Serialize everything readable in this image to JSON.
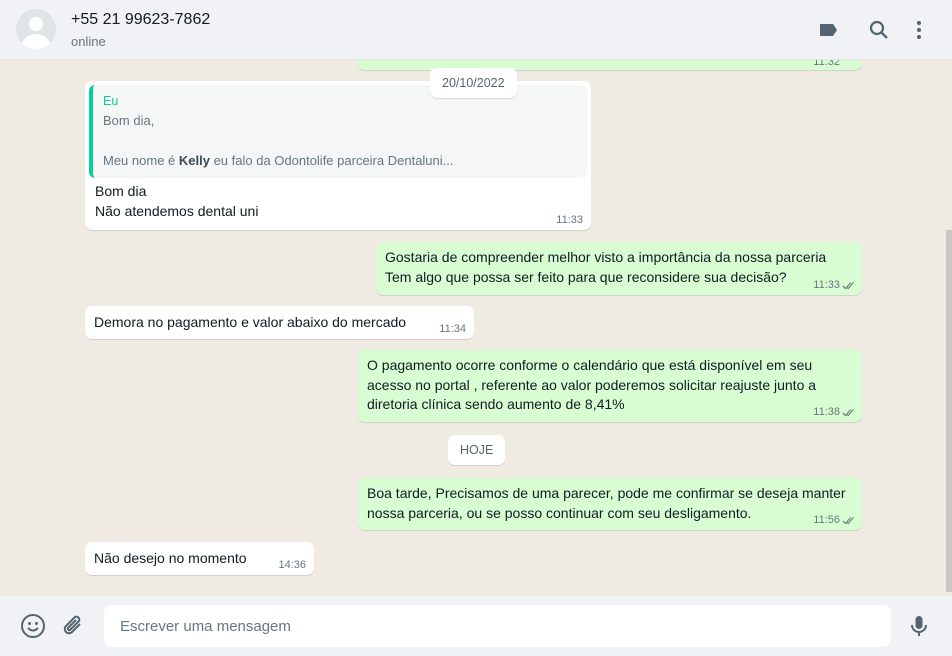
{
  "header": {
    "contact_name": "+55 21 99623-7862",
    "status": "online"
  },
  "messages": [
    {
      "dir": "out",
      "text": "",
      "time": "11:32"
    },
    {
      "type": "date",
      "text": "20/10/2022"
    },
    {
      "dir": "in",
      "quote": {
        "author": "Eu",
        "line1": "Bom dia,",
        "line2_pre": "Meu nome é ",
        "line2_bold": "Kelly",
        "line2_post": " eu falo da Odontolife parceira Dentaluni..."
      },
      "lines": [
        "Bom dia",
        "Não atendemos dental uni"
      ],
      "time": "11:33"
    },
    {
      "dir": "out",
      "lines": [
        "Gostaria de compreender melhor visto a importância da nossa parceria",
        "Tem algo que possa ser feito para que reconsidere sua decisão?"
      ],
      "time": "11:33"
    },
    {
      "dir": "in",
      "lines": [
        "Demora no pagamento e valor abaixo do mercado"
      ],
      "time": "11:34"
    },
    {
      "dir": "out",
      "lines": [
        "O pagamento ocorre conforme o calendário que está disponível em seu",
        "acesso no portal , referente ao valor poderemos solicitar reajuste junto a",
        "diretoria clínica sendo aumento de 8,41%"
      ],
      "time": "11:38"
    },
    {
      "type": "date",
      "text": "HOJE"
    },
    {
      "dir": "out",
      "lines": [
        "Boa tarde, Precisamos de uma parecer, pode me confirmar se deseja manter",
        "nossa parceria, ou se posso continuar com seu desligamento."
      ],
      "time": "11:56"
    },
    {
      "dir": "in",
      "lines": [
        "Não desejo no momento"
      ],
      "time": "14:36"
    }
  ],
  "footer": {
    "placeholder": "Escrever uma mensagem"
  },
  "colors": {
    "accent": "#06cf9c",
    "outgoing": "#d9fdd3",
    "background": "#efeae2"
  }
}
